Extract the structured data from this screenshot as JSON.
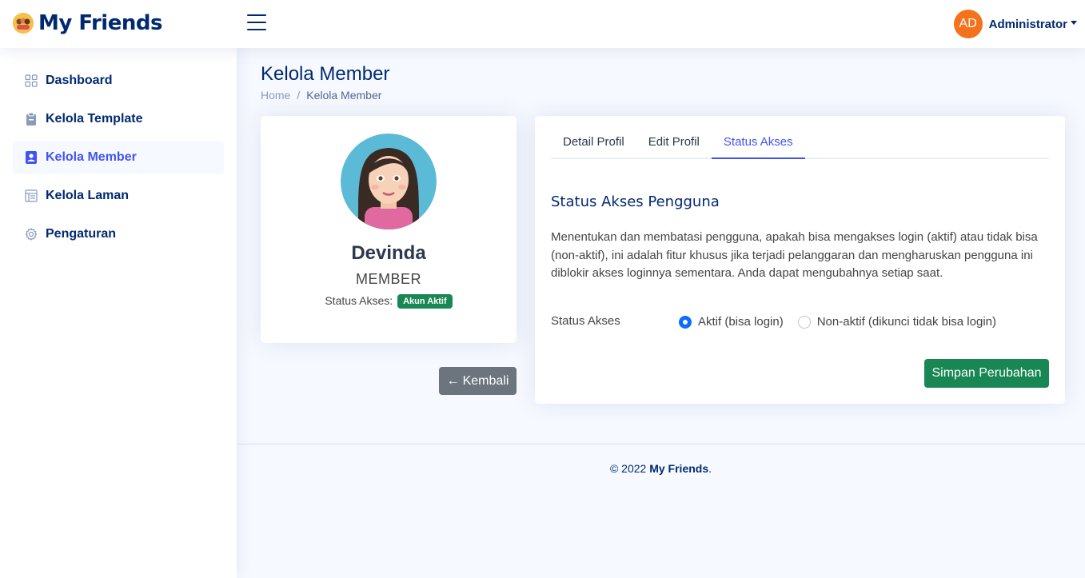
{
  "header": {
    "brand": "My Friends",
    "user_initials": "AD",
    "user_name": "Administrator",
    "colors": {
      "avatar_bg": "#f5721c",
      "brand": "#012970"
    }
  },
  "sidebar": {
    "items": [
      {
        "label": "Dashboard",
        "icon": "grid-icon",
        "active": false
      },
      {
        "label": "Kelola Template",
        "icon": "clipboard-icon",
        "active": false
      },
      {
        "label": "Kelola Member",
        "icon": "person-badge-icon",
        "active": true
      },
      {
        "label": "Kelola Laman",
        "icon": "layout-icon",
        "active": false
      },
      {
        "label": "Pengaturan",
        "icon": "gear-icon",
        "active": false
      }
    ]
  },
  "page": {
    "title": "Kelola Member",
    "breadcrumb": {
      "home": "Home",
      "sep": "/",
      "current": "Kelola Member"
    }
  },
  "profile": {
    "name": "Devinda",
    "role": "MEMBER",
    "status_label": "Status Akses:",
    "status_badge": "Akun Aktif",
    "back_icon": "←",
    "back_label": "Kembali"
  },
  "tabs": [
    {
      "label": "Detail Profil",
      "active": false
    },
    {
      "label": "Edit Profil",
      "active": false
    },
    {
      "label": "Status Akses",
      "active": true
    }
  ],
  "access": {
    "title": "Status Akses Pengguna",
    "description": "Menentukan dan membatasi pengguna, apakah bisa mengakses login (aktif) atau tidak bisa (non-aktif), ini adalah fitur khusus jika terjadi pelanggaran dan mengharuskan pengguna ini diblokir akses loginnya sementara. Anda dapat mengubahnya setiap saat.",
    "field_label": "Status Akses",
    "options": [
      {
        "label": "Aktif (bisa login)",
        "checked": true
      },
      {
        "label": "Non-aktif (dikunci tidak bisa login)",
        "checked": false
      }
    ],
    "save_label": "Simpan Perubahan"
  },
  "footer": {
    "copyright": "© 2022",
    "brand": "My Friends",
    "suffix": "."
  }
}
